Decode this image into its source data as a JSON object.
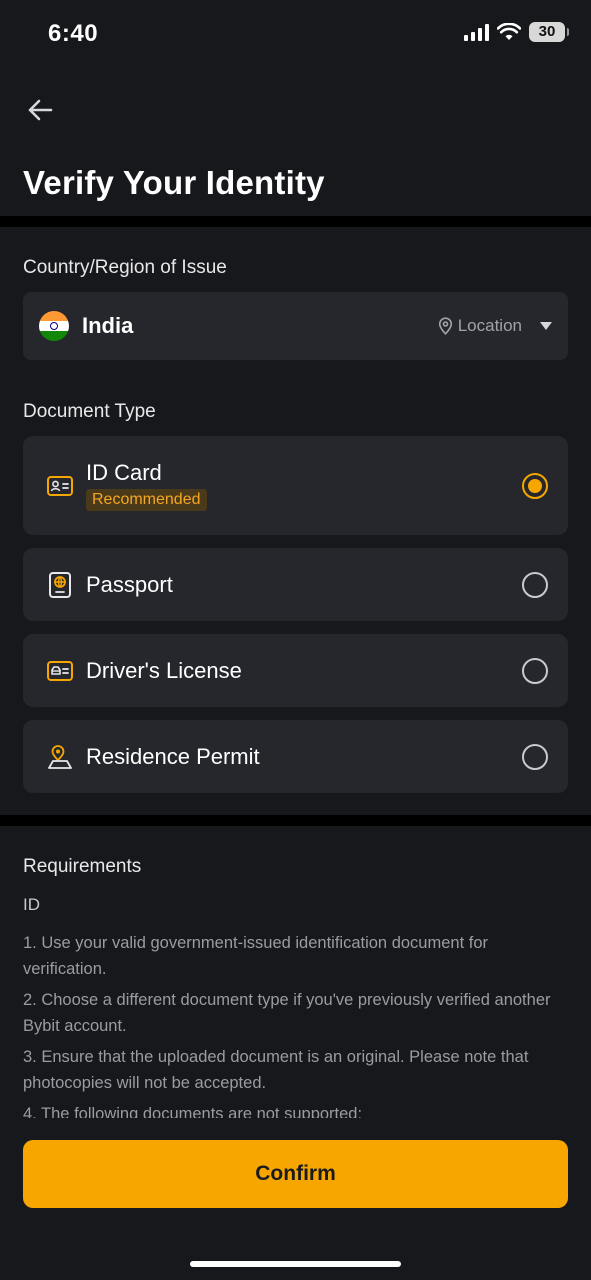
{
  "status_bar": {
    "time": "6:40",
    "battery": "30"
  },
  "header": {
    "title": "Verify Your Identity"
  },
  "country": {
    "section_label": "Country/Region of Issue",
    "selected": "India",
    "location_label": "Location"
  },
  "document_type": {
    "section_label": "Document Type",
    "options": [
      {
        "label": "ID Card",
        "badge": "Recommended",
        "selected": true
      },
      {
        "label": "Passport",
        "selected": false
      },
      {
        "label": "Driver's License",
        "selected": false
      },
      {
        "label": "Residence Permit",
        "selected": false
      }
    ]
  },
  "requirements": {
    "title": "Requirements",
    "subtitle": "ID",
    "items": [
      "1. Use your valid government-issued identification document for verification.",
      "2. Choose a different document type if you've previously verified another Bybit account.",
      "3. Ensure that the uploaded document is an original. Please note that photocopies will not be accepted.",
      "4. The following documents are not supported:"
    ]
  },
  "confirm_label": "Confirm",
  "colors": {
    "accent": "#f7a600",
    "background": "#17181c",
    "card": "#25272c"
  },
  "icons": {
    "back": "arrow-left-icon",
    "location": "location-pin-icon",
    "dropdown": "caret-down-icon",
    "id_card": "id-card-icon",
    "passport": "passport-icon",
    "drivers_license": "drivers-license-icon",
    "residence_permit": "residence-permit-icon"
  }
}
